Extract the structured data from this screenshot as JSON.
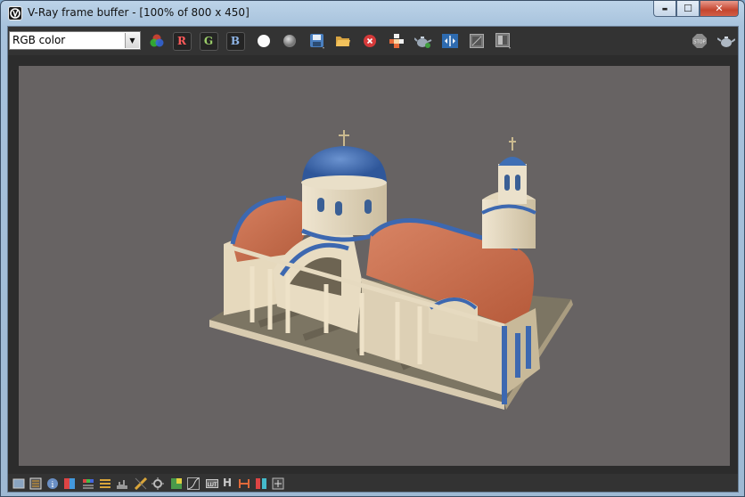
{
  "window": {
    "title": "V-Ray frame buffer - [100% of 800 x 450]",
    "buttons": {
      "minimize": "▬",
      "maximize": "☐",
      "close": "✕"
    }
  },
  "toolbar": {
    "channel_select": {
      "value": "RGB color",
      "arrow": "▼"
    },
    "red_channel_label": "R",
    "green_channel_label": "G",
    "blue_channel_label": "B",
    "icons": [
      "color-wheel-icon",
      "white-circle-icon",
      "gray-circle-icon",
      "save-icon",
      "open-folder-icon",
      "clear-icon",
      "region-render-icon",
      "teapot-render-icon",
      "compare-icon",
      "history-icon",
      "corrections-icon",
      "stop-icon",
      "teapot-icon"
    ]
  },
  "bottombar": {
    "icons": [
      "display-correction-icon",
      "pixel-info-icon",
      "info-icon",
      "color-correction-icon",
      "levels-icon",
      "curves-icon",
      "histogram-icon",
      "exposure-icon",
      "lens-effects-icon",
      "white-balance-icon",
      "curve-graph-icon",
      "lut-icon",
      "h-icon",
      "ocio-icon",
      "stereo-icon",
      "settings-icon"
    ],
    "h_label": "H"
  },
  "colors": {
    "toolbar_bg": "#333333",
    "viewport_bg": "#676363",
    "dome": "#3f6fb4",
    "roof": "#c9714d",
    "walls": "#e8dcc4"
  }
}
